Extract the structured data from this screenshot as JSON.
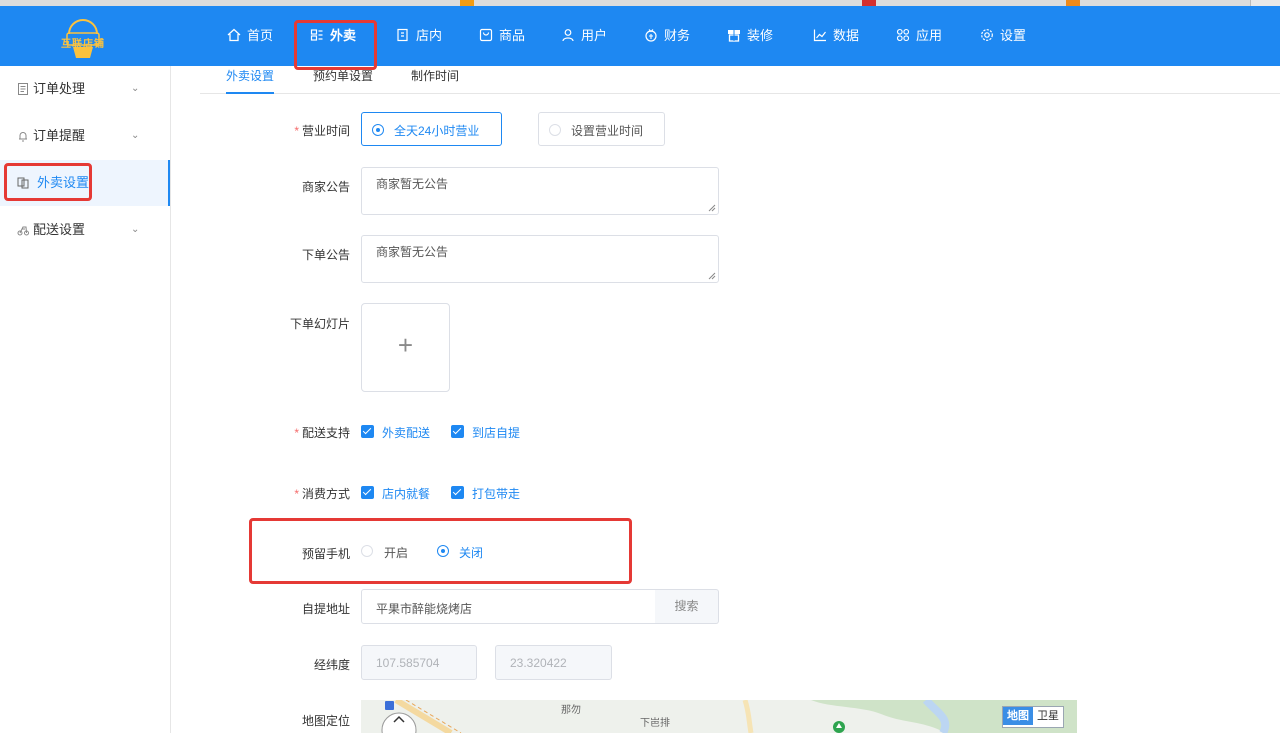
{
  "nav": {
    "logo_text": "互联店铺",
    "items": [
      {
        "label": "首页",
        "icon": "home-icon"
      },
      {
        "label": "外卖",
        "icon": "takeout-icon"
      },
      {
        "label": "店内",
        "icon": "store-inside-icon"
      },
      {
        "label": "商品",
        "icon": "goods-icon"
      },
      {
        "label": "用户",
        "icon": "user-icon"
      },
      {
        "label": "财务",
        "icon": "finance-icon"
      },
      {
        "label": "装修",
        "icon": "decoration-icon"
      },
      {
        "label": "数据",
        "icon": "chart-icon"
      },
      {
        "label": "应用",
        "icon": "apps-icon"
      },
      {
        "label": "设置",
        "icon": "gear-icon"
      }
    ]
  },
  "sidebar": {
    "items": [
      {
        "label": "订单处理",
        "icon": "document-icon",
        "expandable": true
      },
      {
        "label": "订单提醒",
        "icon": "bell-icon",
        "expandable": true
      },
      {
        "label": "外卖设置",
        "icon": "takeout-settings-icon",
        "expandable": false
      },
      {
        "label": "配送设置",
        "icon": "delivery-icon",
        "expandable": true
      }
    ]
  },
  "tabs": [
    "外卖设置",
    "预约单设置",
    "制作时间"
  ],
  "form": {
    "business_hours": {
      "label": "营业时间",
      "options": [
        "全天24小时营业",
        "设置营业时间"
      ],
      "selected": "全天24小时营业"
    },
    "merchant_notice": {
      "label": "商家公告",
      "value": "商家暂无公告"
    },
    "order_notice": {
      "label": "下单公告",
      "value": "商家暂无公告"
    },
    "slideshow": {
      "label": "下单幻灯片",
      "upload_glyph": "+"
    },
    "delivery_support": {
      "label": "配送支持",
      "options": [
        "外卖配送",
        "到店自提"
      ]
    },
    "consumption": {
      "label": "消费方式",
      "options": [
        "店内就餐",
        "打包带走"
      ]
    },
    "reserve_phone": {
      "label": "预留手机",
      "options": [
        "开启",
        "关闭"
      ],
      "selected": "关闭"
    },
    "pickup_address": {
      "label": "自提地址",
      "value": "平果市醉能烧烤店",
      "search_label": "搜索"
    },
    "coordinates": {
      "label": "经纬度",
      "longitude": "107.585704",
      "latitude": "23.320422"
    },
    "map": {
      "label": "地图定位",
      "toggle": [
        "地图",
        "卫星"
      ],
      "selected": "地图",
      "place_labels": [
        "那勿",
        "下岜排"
      ]
    }
  },
  "colors": {
    "primary": "#1e88f2",
    "highlight": "#e53935",
    "required": "#f56c6c"
  }
}
